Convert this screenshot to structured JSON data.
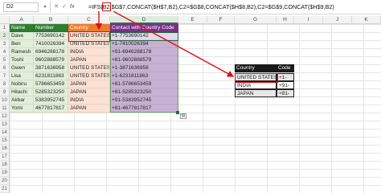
{
  "formula_bar": {
    "name_box": "D2",
    "fx": "fx",
    "formula_prefix": "=IFS(",
    "formula_highlight": "B2",
    "formula_rest": ",$G$7,CONCAT($H$7,B2),C2=$G$8,CONCAT($H$8,B2),C2=$G$9,CONCAT($H$9,B2)"
  },
  "columns": [
    "A",
    "B",
    "C",
    "D",
    "E",
    "F",
    "G",
    "H",
    "I",
    "J",
    "K"
  ],
  "rows": [
    "1",
    "2",
    "3",
    "4",
    "5",
    "6",
    "7",
    "8",
    "9",
    "10",
    "11",
    "12",
    "13",
    "14",
    "15",
    "16",
    "17",
    "18",
    "19",
    "20",
    "21"
  ],
  "table": {
    "headers": {
      "name": "Name",
      "number": "Number",
      "country": "Country",
      "contact": "Contact with Country Code"
    },
    "rows": [
      {
        "name": "Dave",
        "number": "7753690142",
        "country": "UNITED STATES",
        "contact": "+1-7753690142"
      },
      {
        "name": "Ben",
        "number": "7410026394",
        "country": "UNITED STATES",
        "contact": "+1-7410026394"
      },
      {
        "name": "Ramesh",
        "number": "6946288178",
        "country": "INDIA",
        "contact": "+91-6946288178"
      },
      {
        "name": "Toshi",
        "number": "9602888579",
        "country": "JAPAN",
        "contact": "+81-9602888579"
      },
      {
        "name": "Gwen",
        "number": "3871636958",
        "country": "UNITED STATES",
        "contact": "+1-3871636958"
      },
      {
        "name": "Lisa",
        "number": "6231811863",
        "country": "UNITED STATES",
        "contact": "+1-6231811863"
      },
      {
        "name": "Nobiru",
        "number": "5786653459",
        "country": "JAPAN",
        "contact": "+81-5786653459"
      },
      {
        "name": "Hitachi",
        "number": "5285323250",
        "country": "JAPAN",
        "contact": "+81-5285323250"
      },
      {
        "name": "Akbar",
        "number": "5383952745",
        "country": "INDIA",
        "contact": "+91-5383952745"
      },
      {
        "name": "Yomi",
        "number": "4677817817",
        "country": "JAPAN",
        "contact": "+81-4677817817"
      }
    ]
  },
  "lookup": {
    "headers": {
      "country": "Country",
      "code": "Code"
    },
    "rows": [
      {
        "country": "UNITED STATES",
        "code": "+1-"
      },
      {
        "country": "INDIA",
        "code": "+91-"
      },
      {
        "country": "JAPAN",
        "code": "+81-"
      }
    ]
  },
  "colors": {
    "name_header": "#2e7d32",
    "country_header": "#f07b2a",
    "contact_header": "#7b2f8c",
    "annotation": "#d11111"
  }
}
